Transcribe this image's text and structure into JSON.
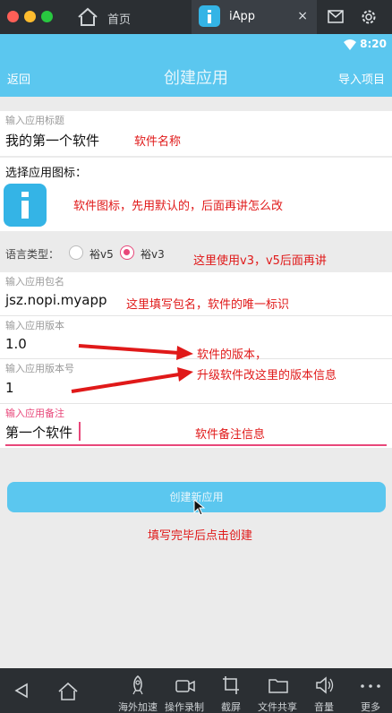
{
  "window": {
    "traffic_lights": [
      "#ff5f57",
      "#febc2e",
      "#28c840"
    ],
    "tabs": [
      {
        "label": "首页"
      },
      {
        "label": "iApp"
      }
    ],
    "close_glyph": "×"
  },
  "status": {
    "time": "8:20"
  },
  "nav": {
    "back": "返回",
    "title": "创建应用",
    "import": "导入项目"
  },
  "form": {
    "title_hint": "输入应用标题",
    "title_value": "我的第一个软件",
    "icon_label": "选择应用图标：",
    "lang_label": "语言类型：",
    "lang_options": [
      {
        "label": "裕v5",
        "selected": false
      },
      {
        "label": "裕v3",
        "selected": true
      }
    ],
    "package_hint": "输入应用包名",
    "package_value": "jsz.nopi.myapp",
    "version_hint": "输入应用版本",
    "version_value": "1.0",
    "version_code_hint": "输入应用版本号",
    "version_code_value": "1",
    "remark_hint": "输入应用备注",
    "remark_value": "第一个软件",
    "create_button": "创建新应用"
  },
  "notes": {
    "name": "软件名称",
    "icon": "软件图标，先用默认的，后面再讲怎么改",
    "lang": "这里使用v3，v5后面再讲",
    "package": "这里填写包名，软件的唯一标识",
    "version": "软件的版本，",
    "version_code": "升级软件改这里的版本信息",
    "remark": "软件备注信息",
    "create": "填写完毕后点击创建"
  },
  "toolbar": {
    "items": [
      {
        "label": "海外加速"
      },
      {
        "label": "操作录制"
      },
      {
        "label": "截屏"
      },
      {
        "label": "文件共享"
      },
      {
        "label": "音量"
      },
      {
        "label": "更多"
      }
    ]
  },
  "colors": {
    "accent": "#5bc7ef",
    "annotation": "#e01919",
    "focus": "#e8477a"
  }
}
